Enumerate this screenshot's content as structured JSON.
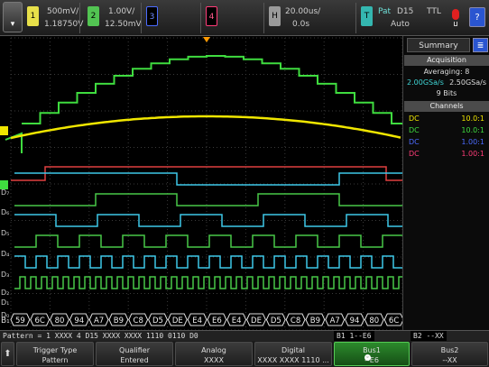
{
  "top_bar": {
    "ch1": {
      "number": "1",
      "scale": "500mV/",
      "offset": "1.18750V"
    },
    "ch2": {
      "number": "2",
      "scale": "1.00V/",
      "offset": "12.50mV"
    },
    "ch3": {
      "number": "3"
    },
    "ch4": {
      "number": "4"
    },
    "horizontal": {
      "key": "H",
      "scale": "20.00us/",
      "delay": "0.0s"
    },
    "trigger": {
      "key": "T",
      "type": "Pat",
      "source": "D15",
      "level": "TTL",
      "mode": "Auto"
    }
  },
  "summary": {
    "tab_label": "Summary",
    "acquisition_header": "Acquisition",
    "averaging": "Averaging: 8",
    "sample_rate_left": "2.00GSa/s",
    "sample_rate_right": "2.50GSa/s",
    "bits": "9 Bits",
    "channels_header": "Channels",
    "channels": [
      {
        "coupling": "DC",
        "probe": "10.0:1",
        "color": "#f0e600"
      },
      {
        "coupling": "DC",
        "probe": "10.0:1",
        "color": "#3fdc3f"
      },
      {
        "coupling": "DC",
        "probe": "1.00:1",
        "color": "#4b6bff"
      },
      {
        "coupling": "DC",
        "probe": "1.00:1",
        "color": "#ff3c78"
      }
    ]
  },
  "digital_labels": [
    "D₇",
    "D₆",
    "D₅",
    "D₄",
    "D₃",
    "D₂",
    "D₁",
    "D₀"
  ],
  "bus": {
    "label": "B₁",
    "values": [
      "59",
      "6C",
      "80",
      "94",
      "A7",
      "B9",
      "C8",
      "D5",
      "DE",
      "E4",
      "E6",
      "E4",
      "DE",
      "D5",
      "C8",
      "B9",
      "A7",
      "94",
      "80",
      "6C"
    ]
  },
  "pattern_bar": {
    "text": "Pattern = 1 XXXX 4 D15 XXXX XXXX 1110 0110 D0",
    "b1": "B1 1--E6",
    "b2": "B2 --XX"
  },
  "softkeys": [
    {
      "title": "Trigger Type",
      "value": "Pattern"
    },
    {
      "title": "Qualifier",
      "value": "Entered"
    },
    {
      "title": "Analog",
      "value": "XXXX"
    },
    {
      "title": "Digital",
      "value": "XXXX XXXX 1110 ..."
    },
    {
      "title": "Bus1",
      "value": "--E6"
    },
    {
      "title": "Bus2",
      "value": "--XX"
    }
  ],
  "colors": {
    "ch1": "#f0e600",
    "ch2": "#3fdc3f",
    "ch3": "#4b6bff",
    "ch4": "#ff3c78",
    "digital_a": "#3ec8e8",
    "digital_b": "#48c848",
    "trigger_marker": "#ff9a00"
  }
}
